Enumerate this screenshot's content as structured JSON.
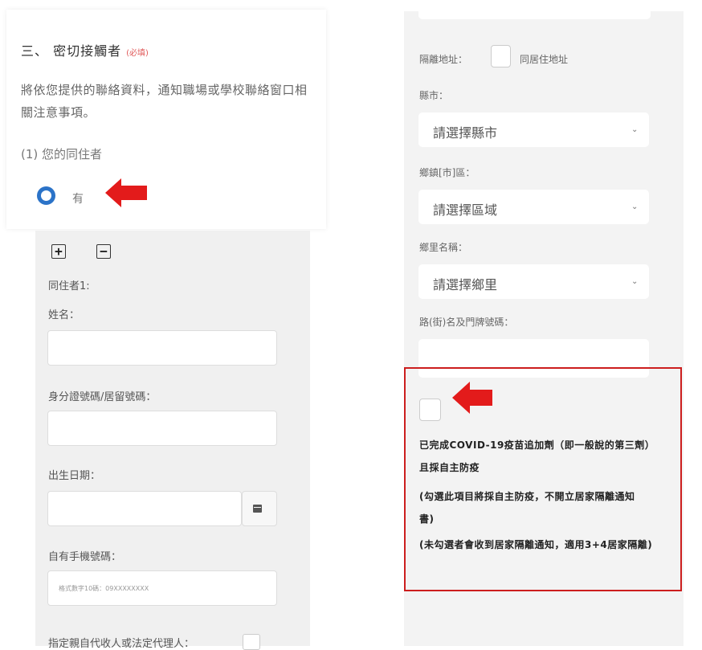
{
  "left": {
    "section_title": "三、 密切接觸者",
    "required_tag": "(必填)",
    "description": "將依您提供的聯絡資料，通知職場或學校聯絡窗口相關注意事項。",
    "question": "(1) 您的同住者",
    "radio_option": "有",
    "add_symbol": "+",
    "remove_symbol": "−",
    "cohabitant_heading": "同住者1:",
    "name_label": "姓名：",
    "id_label": "身分證號碼/居留號碼：",
    "birth_label": "出生日期：",
    "mobile_label": "自有手機號碼：",
    "mobile_placeholder": "格式數字10碼：09XXXXXXXX",
    "guardian_label": "指定親自代收人或法定代理人："
  },
  "right": {
    "address_label": "隔離地址：",
    "same_address_label": "同居住地址",
    "county_label": "縣市：",
    "county_select": "請選擇縣市",
    "district_label": "鄉鎮[市]區：",
    "district_select": "請選擇區域",
    "village_label": "鄉里名稱：",
    "village_select": "請選擇鄉里",
    "street_label": "路(街)名及門牌號碼：",
    "booster_note_1": "已完成COVID-19疫苗追加劑（即一般說的第三劑）且採自主防疫",
    "booster_note_2": "(勾選此項目將採自主防疫，不開立居家隔離通知書)",
    "booster_note_3": "(未勾選者會收到居家隔離通知，適用3+4居家隔離)"
  },
  "colors": {
    "radio": "#2b73c8",
    "arrow": "#e31b1b",
    "highlight_box": "#cc1e1e",
    "required": "#e05a5a"
  },
  "icons": [
    "plus-icon",
    "minus-icon",
    "calendar-icon",
    "chevron-down-icon",
    "arrow-icon"
  ]
}
